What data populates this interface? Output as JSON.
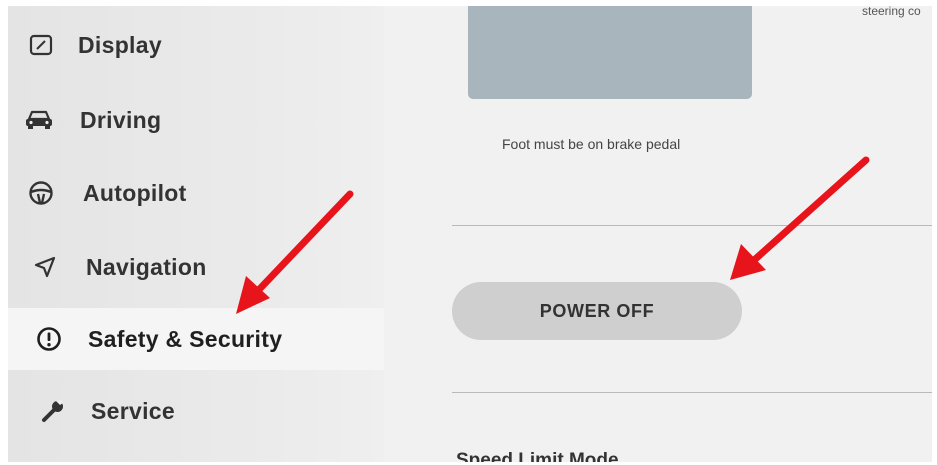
{
  "sidebar": {
    "items": [
      {
        "label": "Display",
        "icon": "display-icon"
      },
      {
        "label": "Driving",
        "icon": "car-icon"
      },
      {
        "label": "Autopilot",
        "icon": "steering-wheel-icon"
      },
      {
        "label": "Navigation",
        "icon": "navigation-arrow-icon"
      },
      {
        "label": "Safety & Security",
        "icon": "exclamation-circle-icon",
        "active": true
      },
      {
        "label": "Service",
        "icon": "wrench-icon"
      }
    ]
  },
  "content": {
    "corner_text": "steering co",
    "preview_text": "",
    "note": "Foot must be on brake pedal",
    "power_button": "POWER OFF",
    "next_section": "Speed Limit Mode"
  },
  "annotations": {
    "arrow_color": "#e8141b"
  }
}
